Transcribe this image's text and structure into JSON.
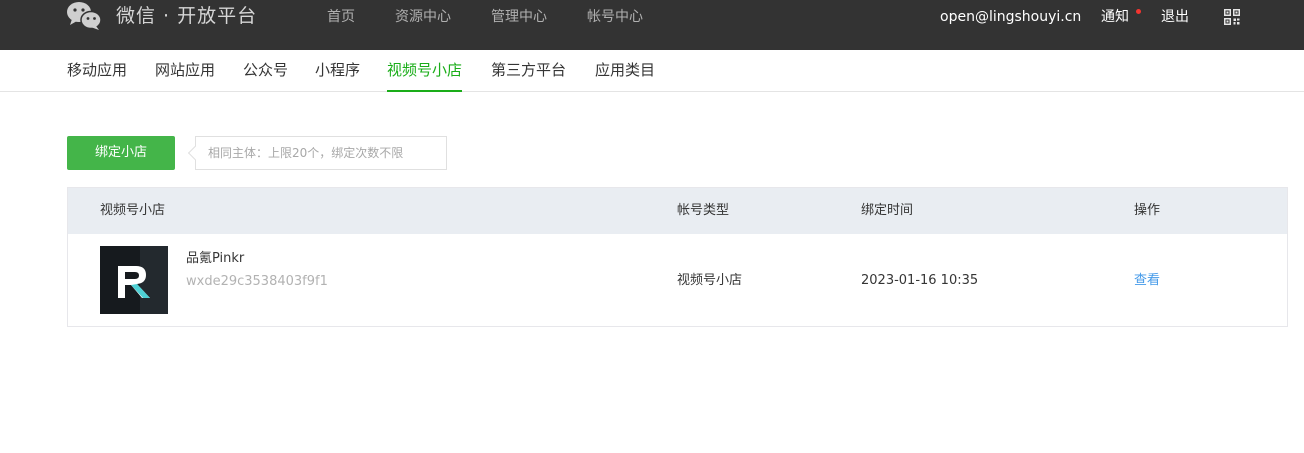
{
  "header": {
    "brand_title": "微信 · 开放平台",
    "nav": [
      "首页",
      "资源中心",
      "管理中心",
      "帐号中心"
    ],
    "account": "open@lingshouyi.cn",
    "notify": "通知",
    "logout": "退出",
    "colors": {
      "bg": "#333333",
      "notify_dot": "#f43530"
    }
  },
  "subnav": {
    "items": [
      "移动应用",
      "网站应用",
      "公众号",
      "小程序",
      "视频号小店",
      "第三方平台",
      "应用类目"
    ],
    "active": "视频号小店",
    "active_color": "#1aad19"
  },
  "toolbar": {
    "bind_label": "绑定小店",
    "tip": "相同主体：上限20个，绑定次数不限"
  },
  "table": {
    "headers": [
      "视频号小店",
      "帐号类型",
      "绑定时间",
      "操作"
    ],
    "rows": [
      {
        "name": "品氪Pinkr",
        "id": "wxde29c3538403f9f1",
        "type": "视频号小店",
        "time": "2023-01-16 10:35",
        "action": "查看"
      }
    ]
  }
}
